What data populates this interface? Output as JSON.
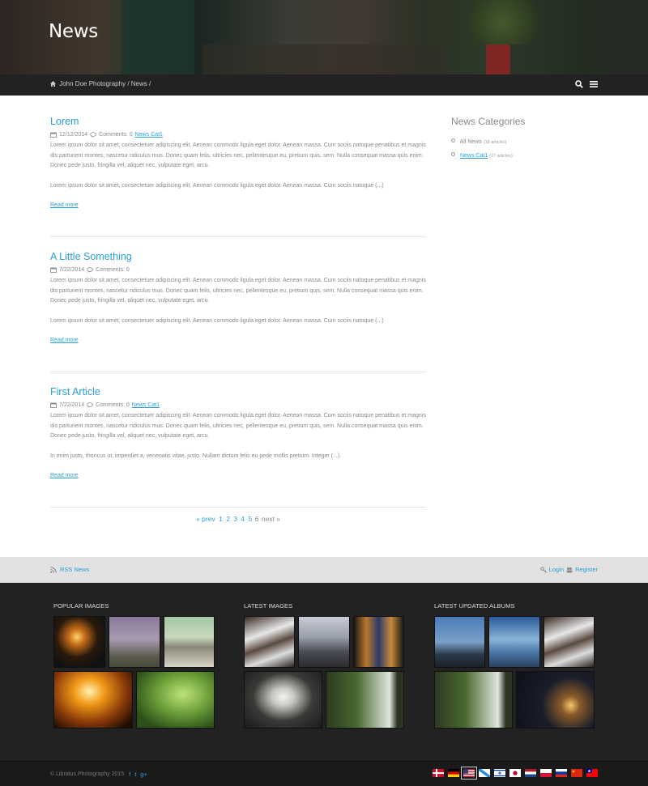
{
  "header": {
    "title": "News",
    "breadcrumb": {
      "home": "John Doe Photography",
      "sep1": "/",
      "current": "News",
      "sep2": "/"
    }
  },
  "articles": [
    {
      "title": "Lorem",
      "date": "12/12/2014",
      "comments": "Comments: 0",
      "category": "News Cat1",
      "p1": "Lorem ipsum dolor sit amet, consectetuer adipiscing elit. Aenean commodo ligula eget dolor. Aenean massa. Cum sociis natoque penatibus et magnis dis parturient montes, nascetur ridiculus mus. Donec quam felis, ultricies nec, pellentesque eu, pretium quis, sem. Nulla consequat massa quis enim. Donec pede justo, fringilla vel, aliquet nec, vulputate eget, arcu.",
      "p2": "Lorem ipsum dolor sit amet, consectetuer adipiscing elit. Aenean commodo ligula eget dolor. Aenean massa. Cum sociis natoque (...)",
      "read_more": "Read more"
    },
    {
      "title": "A Little Something",
      "date": "7/22/2014",
      "comments": "Comments: 0",
      "category": "",
      "p1": "Lorem ipsum dolor sit amet, consectetuer adipiscing elit. Aenean commodo ligula eget dolor. Aenean massa. Cum sociis natoque penatibus et magnis dis parturient montes, nascetur ridiculus mus. Donec quam felis, ultricies nec, pellentesque eu, pretium quis, sem. Nulla consequat massa quis enim. Donec pede justo, fringilla vel, aliquet nec, vulputate eget, arcu.",
      "p2": "Lorem ipsum dolor sit amet, consectetuer adipiscing elit. Aenean commodo ligula eget dolor. Aenean massa. Cum sociis natoque (...)",
      "read_more": "Read more"
    },
    {
      "title": "First Article",
      "date": "7/22/2014",
      "comments": "Comments: 0",
      "category": "News Cat1",
      "p1": "Lorem ipsum dolor sit amet, consectetuer adipiscing elit. Aenean commodo ligula eget dolor. Aenean massa. Cum sociis natoque penatibus et magnis dis parturient montes, nascetur ridiculus mus. Donec quam felis, ultricies nec, pellentesque eu, pretium quis, sem. Nulla consequat massa quis enim. Donec pede justo, fringilla vel, aliquet nec, vulputate eget, arcu.",
      "p2": "In enim justo, rhoncus ut, imperdiet a, venenatis vitae, justo. Nullam dictum felis eu pede mollis pretium. Integer (...)",
      "read_more": "Read more"
    }
  ],
  "pagination": {
    "prev": "« prev",
    "pages": [
      "1",
      "2",
      "3",
      "4",
      "5"
    ],
    "current": "6",
    "next": "next »"
  },
  "sidebar": {
    "title": "News Categories",
    "items": [
      {
        "label": "All News",
        "count": "(18 articles)"
      },
      {
        "label": "News Cat1",
        "count": "(17 articles)"
      }
    ]
  },
  "strip": {
    "rss": "RSS News",
    "login": "Login",
    "register": "Register"
  },
  "footer": {
    "popular_title": "POPULAR IMAGES",
    "latest_title": "LATEST IMAGES",
    "albums_title": "LATEST UPDATED ALBUMS",
    "copyright": "© Libratus Photography 2015",
    "social": [
      "f",
      "t",
      "g+"
    ]
  },
  "colors": {
    "accent": "#2a9fd6",
    "nav": "#222222",
    "footer": "#222222",
    "strip": "#e2e2e2"
  }
}
